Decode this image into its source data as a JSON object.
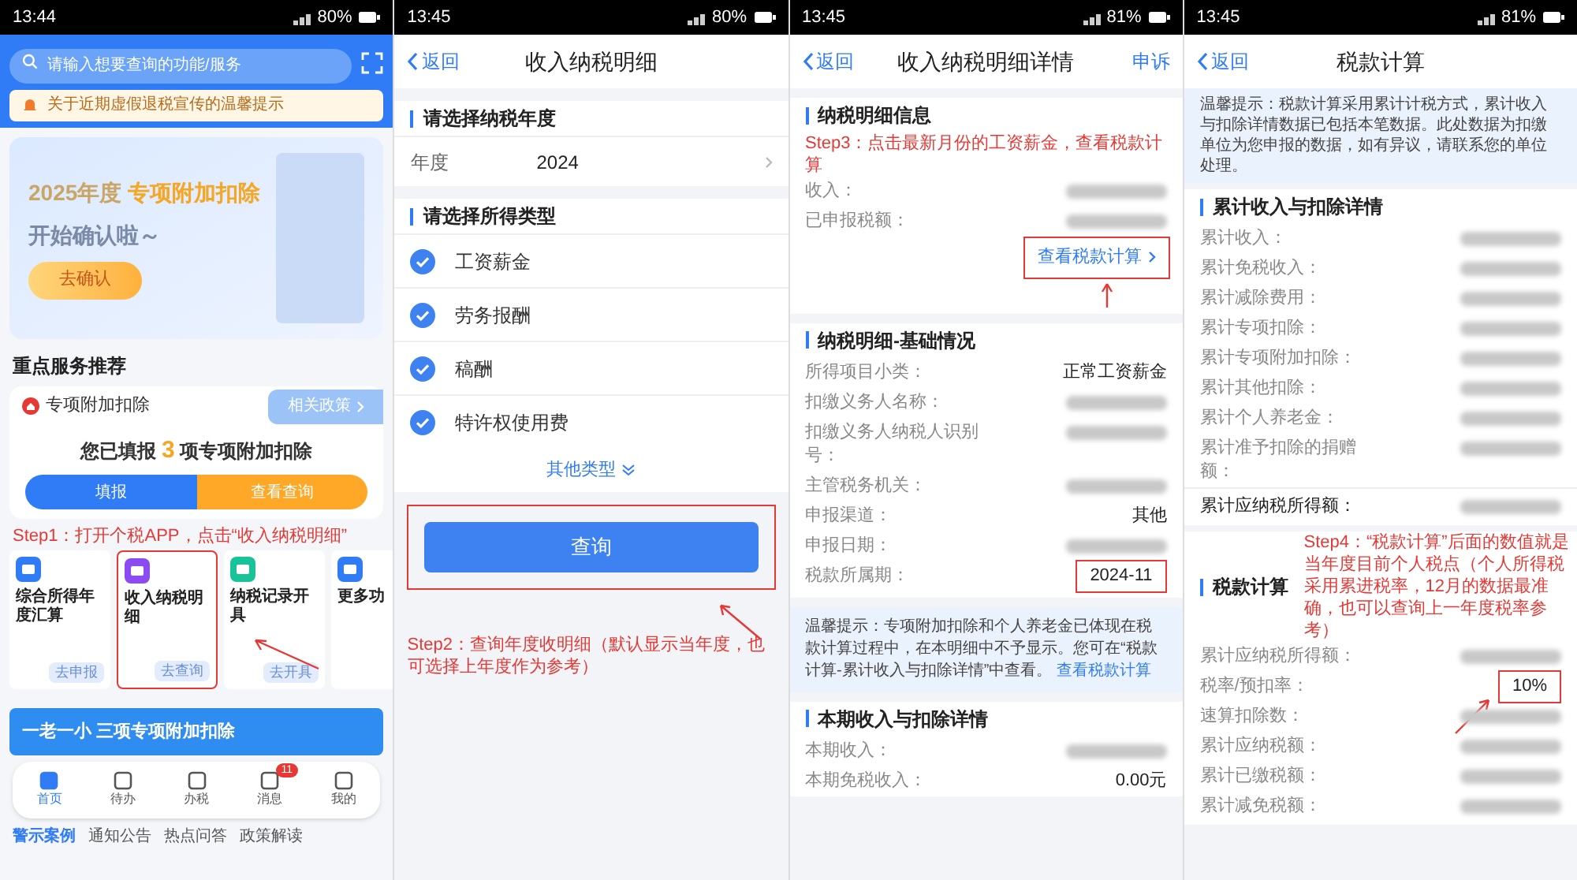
{
  "panels": [
    {
      "kind": "home",
      "status": {
        "time": "13:44",
        "battery": "80%"
      },
      "search": {
        "placeholder": "请输入想要查询的功能/服务"
      },
      "notice": "关于近期虚假退税宣传的温馨提示",
      "banner": {
        "year": "2025年度",
        "highlight": "专项附加扣除",
        "subtitle": "开始确认啦～",
        "button": "去确认"
      },
      "section_title": "重点服务推荐",
      "card": {
        "title": "专项附加扣除",
        "policy_button": "相关政策",
        "summary_prefix": "您已填报",
        "count": "3",
        "summary_suffix": "项专项附加扣除",
        "buttons": [
          {
            "label": "填报",
            "selected": false
          },
          {
            "label": "查看查询",
            "selected": true
          }
        ]
      },
      "services": [
        {
          "title": "综合所得年度汇算",
          "action": "去申报",
          "color": "#2f7cf6",
          "highlighted": false
        },
        {
          "title": "收入纳税明细",
          "action": "去查询",
          "color": "#8a4cf0",
          "highlighted": true
        },
        {
          "title": "纳税记录开具",
          "action": "去开具",
          "color": "#19c39a",
          "highlighted": false
        },
        {
          "title": "更多功",
          "color": "#2f7cf6",
          "highlighted": false
        }
      ],
      "promo": "一老一小 三项专项附加扣除",
      "tabbar": [
        {
          "label": "首页",
          "selected": true
        },
        {
          "label": "待办",
          "selected": false
        },
        {
          "label": "办税",
          "selected": false
        },
        {
          "label": "消息",
          "selected": false,
          "badge": "11"
        },
        {
          "label": "我的",
          "selected": false
        }
      ],
      "news_tabs": [
        {
          "label": "警示案例",
          "selected": true
        },
        {
          "label": "通知公告",
          "selected": false
        },
        {
          "label": "热点问答",
          "selected": false
        },
        {
          "label": "政策解读",
          "selected": false
        }
      ],
      "annotation": "Step1：打开个税APP，点击“收入纳税明细”"
    },
    {
      "kind": "query",
      "status": {
        "time": "13:45",
        "battery": "80%"
      },
      "back": "返回",
      "title": "收入纳税明细",
      "year_section": "请选择纳税年度",
      "year_label": "年度",
      "year_value": "2024",
      "type_section": "请选择所得类型",
      "options": [
        {
          "label": "工资薪金",
          "checked": true
        },
        {
          "label": "劳务报酬",
          "checked": true
        },
        {
          "label": "稿酬",
          "checked": true
        },
        {
          "label": "特许权使用费",
          "checked": true
        }
      ],
      "more": "其他类型",
      "button": "查询",
      "annotation": "Step2：查询年度收明细（默认显示当年度，也可选择上年度作为参考）"
    },
    {
      "kind": "detail",
      "status": {
        "time": "13:45",
        "battery": "81%"
      },
      "back": "返回",
      "title": "收入纳税明细详情",
      "action": "申诉",
      "sections": [
        {
          "title": "纳税明细信息",
          "rows": [
            {
              "label": "收入：",
              "blurred": true
            },
            {
              "label": "已申报税额：",
              "blurred": true
            }
          ],
          "link": "查看税款计算"
        },
        {
          "title": "纳税明细-基础情况",
          "rows": [
            {
              "label": "所得项目小类：",
              "value": "正常工资薪金"
            },
            {
              "label": "扣缴义务人名称：",
              "blurred": true
            },
            {
              "label": "扣缴义务人纳税人识别号：",
              "blurred": true
            },
            {
              "label": "主管税务机关：",
              "blurred": true
            },
            {
              "label": "申报渠道：",
              "value": "其他"
            },
            {
              "label": "申报日期：",
              "blurred": true
            },
            {
              "label": "税款所属期：",
              "value": "2024-11",
              "highlighted": true
            }
          ]
        }
      ],
      "tip": "温馨提示：专项附加扣除和个人养老金已体现在税款计算过程中，在本明细中不予显示。您可在“税款计算-累计收入与扣除详情”中查看。",
      "tip_link": "查看税款计算",
      "bottom_section": {
        "title": "本期收入与扣除详情",
        "rows": [
          {
            "label": "本期收入：",
            "blurred": true
          },
          {
            "label": "本期免税收入：",
            "value": "0.00元"
          }
        ]
      },
      "annotation": "Step3：点击最新月份的工资薪金，查看税款计算"
    },
    {
      "kind": "calc",
      "status": {
        "time": "13:45",
        "battery": "81%"
      },
      "back": "返回",
      "title": "税款计算",
      "tip": "温馨提示：税款计算采用累计计税方式，累计收入与扣除详情数据已包括本笔数据。此处数据为扣缴单位为您申报的数据，如有异议，请联系您的单位处理。",
      "sections": [
        {
          "title": "累计收入与扣除详情",
          "rows": [
            {
              "label": "累计收入：",
              "blurred": true
            },
            {
              "label": "累计免税收入：",
              "blurred": true
            },
            {
              "label": "累计减除费用：",
              "blurred": true
            },
            {
              "label": "累计专项扣除：",
              "blurred": true
            },
            {
              "label": "累计专项附加扣除：",
              "blurred": true
            },
            {
              "label": "累计其他扣除：",
              "blurred": true
            },
            {
              "label": "累计个人养老金：",
              "blurred": true
            },
            {
              "label": "累计准予扣除的捐赠额：",
              "blurred": true
            }
          ],
          "total": {
            "label": "累计应纳税所得额：",
            "blurred": true
          }
        },
        {
          "title": "税款计算",
          "rows": [
            {
              "label": "累计应纳税所得额：",
              "blurred": true
            },
            {
              "label": "税率/预扣率：",
              "value": "10%",
              "highlighted": true
            },
            {
              "label": "速算扣除数：",
              "blurred": true
            },
            {
              "label": "累计应纳税额：",
              "blurred": true
            },
            {
              "label": "累计已缴税额：",
              "blurred": true
            },
            {
              "label": "累计减免税额：",
              "blurred": true
            }
          ]
        }
      ],
      "annotation": "Step4：“税款计算”后面的数值就是当年度目前个人税点（个人所得税采用累进税率，12月的数据最准确，也可以查询上一年度税率参考）"
    }
  ]
}
